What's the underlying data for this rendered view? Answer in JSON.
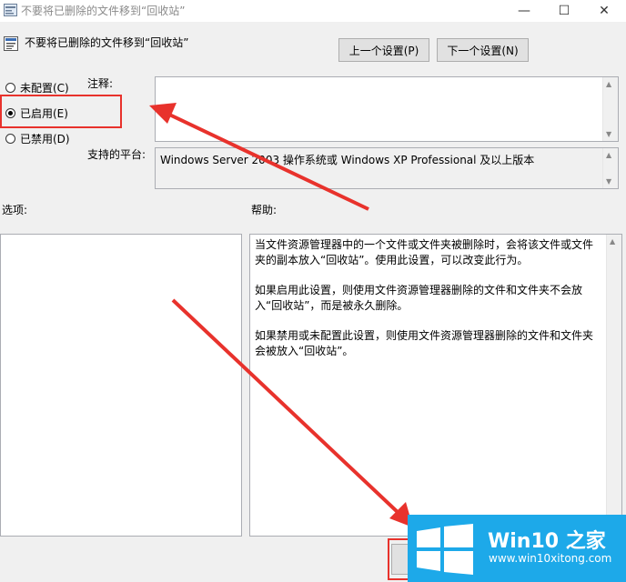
{
  "window": {
    "title": "不要将已删除的文件移到“回收站”",
    "minimize_glyph": "—",
    "maximize_glyph": "☐",
    "close_glyph": "✕"
  },
  "header": {
    "policy_title": "不要将已删除的文件移到“回收站”",
    "prev_button": "上一个设置(P)",
    "next_button": "下一个设置(N)"
  },
  "state": {
    "options": [
      {
        "label": "未配置(C)",
        "checked": false
      },
      {
        "label": "已启用(E)",
        "checked": true
      },
      {
        "label": "已禁用(D)",
        "checked": false
      }
    ]
  },
  "comment": {
    "label": "注释:",
    "value": ""
  },
  "platform": {
    "label": "支持的平台:",
    "value": "Windows Server 2003 操作系统或 Windows XP Professional 及以上版本"
  },
  "options_section": {
    "label": "选项:"
  },
  "help_section": {
    "label": "帮助:",
    "paragraphs": [
      "当文件资源管理器中的一个文件或文件夹被删除时，会将该文件或文件夹的副本放入“回收站”。使用此设置，可以改变此行为。",
      "如果启用此设置，则使用文件资源管理器删除的文件和文件夹不会放入“回收站”，而是被永久删除。",
      "如果禁用或未配置此设置，则使用文件资源管理器删除的文件和文件夹会被放入“回收站”。"
    ]
  },
  "watermark": {
    "title": "Win10 之家",
    "url": "www.win10xitong.com"
  },
  "colors": {
    "annotation_red": "#e8322c",
    "watermark_blue": "#1da9e9"
  }
}
